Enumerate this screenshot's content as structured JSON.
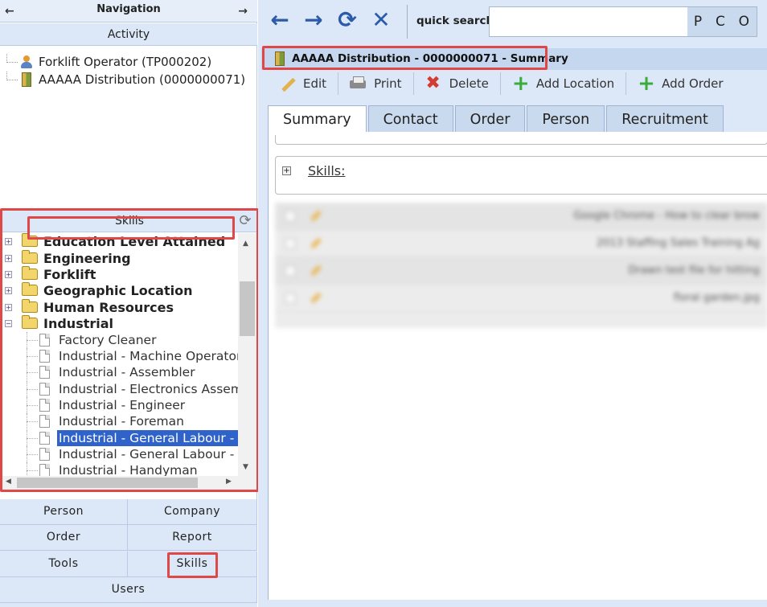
{
  "nav": {
    "title": "Navigation",
    "left_arrow": "←",
    "right_arrow": "→",
    "activity_label": "Activity",
    "activity_items": [
      {
        "label": "Forklift Operator (TP000202)",
        "icon": "person-icon"
      },
      {
        "label": "AAAAA Distribution (0000000071)",
        "icon": "building-icon"
      }
    ]
  },
  "skills_panel": {
    "title": "Skills",
    "refresh_icon": "refresh-icon",
    "folders": [
      {
        "label": "Education Level Attained",
        "expanded": false
      },
      {
        "label": "Engineering",
        "expanded": false
      },
      {
        "label": "Forklift",
        "expanded": false
      },
      {
        "label": "Geographic Location",
        "expanded": false
      },
      {
        "label": "Human Resources",
        "expanded": false
      },
      {
        "label": "Industrial",
        "expanded": true
      }
    ],
    "leaves": [
      {
        "label": "Factory Cleaner"
      },
      {
        "label": "Industrial - Machine Operator"
      },
      {
        "label": "Industrial - Assembler"
      },
      {
        "label": "Industrial - Electronics Assembler"
      },
      {
        "label": "Industrial - Engineer"
      },
      {
        "label": "Industrial - Foreman"
      },
      {
        "label": "Industrial - General Labour - Heavy",
        "selected": true
      },
      {
        "label": "Industrial - General Labour - Light"
      },
      {
        "label": "Industrial - Handyman"
      }
    ]
  },
  "bottom_nav": {
    "person": "Person",
    "company": "Company",
    "order": "Order",
    "report": "Report",
    "tools": "Tools",
    "skills": "Skills",
    "users": "Users"
  },
  "toolbar": {
    "back_icon": "back-arrow-icon",
    "forward_icon": "forward-arrow-icon",
    "refresh_icon": "refresh-icon",
    "close_icon": "close-icon",
    "quick_search_label": "quick search",
    "quick_search_value": "",
    "search_buttons": [
      "P",
      "C",
      "O"
    ]
  },
  "record": {
    "title": "AAAAA Distribution - 0000000071 - Summary",
    "actions": [
      {
        "label": "Edit",
        "icon": "edit-icon"
      },
      {
        "label": "Print",
        "icon": "print-icon"
      },
      {
        "label": "Delete",
        "icon": "delete-icon"
      },
      {
        "label": "Add Location",
        "icon": "add-icon"
      },
      {
        "label": "Add Order",
        "icon": "add-icon"
      }
    ],
    "tabs": [
      {
        "label": "Summary",
        "active": true
      },
      {
        "label": "Contact",
        "active": false
      },
      {
        "label": "Order",
        "active": false
      },
      {
        "label": "Person",
        "active": false
      },
      {
        "label": "Recruitment",
        "active": false
      }
    ],
    "skills_section_label": "Skills:",
    "attachments": [
      {
        "name": "Google Chrome - How to clear brow"
      },
      {
        "name": "2013 Staffing Sales Training Ag"
      },
      {
        "name": "Drawn test file for hitting"
      },
      {
        "name": "floral garden.jpg"
      }
    ]
  },
  "colors": {
    "accent": "#2b5aa8",
    "panel_bg": "#dce8f7",
    "highlight": "#e04848",
    "selection": "#2f63c9"
  }
}
